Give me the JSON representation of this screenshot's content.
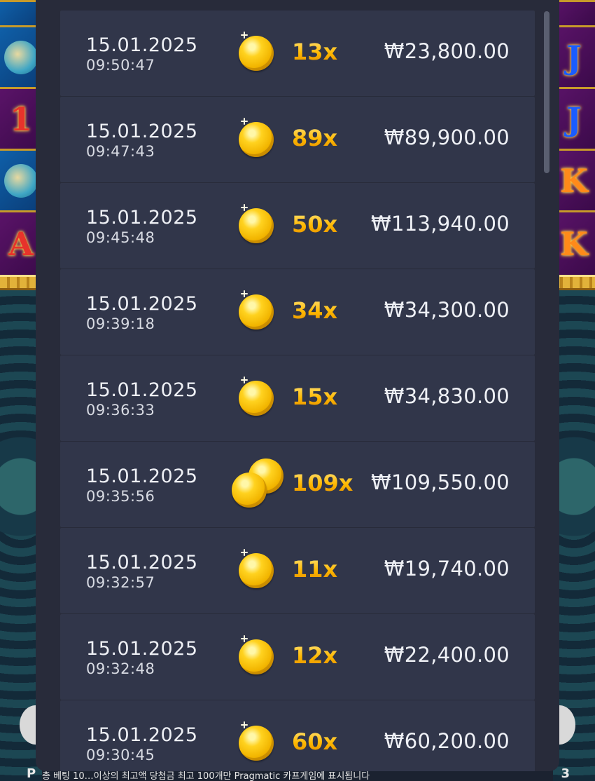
{
  "background": {
    "bottom_text": "총 베팅 10…이상의 최고액 당첨금 최고 100개만 Pragmatic 카프게임에 표시됩니다",
    "left_edge_letter": "P",
    "right_edge_letter": "3",
    "colors": {
      "reel_blue": "#0f5fa8",
      "reel_purple": "#5a1368",
      "gold": "#e2b23a",
      "pattern_teal": "#2e6a6e"
    }
  },
  "panel": {
    "colors": {
      "panel_bg": "#282b3a",
      "row_bg": "#31364a",
      "multiplier": "#ffc21a",
      "text": "#eef0f5"
    },
    "rows": [
      {
        "date": "15.01.2025",
        "time": "09:50:47",
        "multiplier": "13x",
        "amount": "₩23,800.00",
        "coin_icon": "single-coin-icon"
      },
      {
        "date": "15.01.2025",
        "time": "09:47:43",
        "multiplier": "89x",
        "amount": "₩89,900.00",
        "coin_icon": "single-coin-icon"
      },
      {
        "date": "15.01.2025",
        "time": "09:45:48",
        "multiplier": "50x",
        "amount": "₩113,940.00",
        "coin_icon": "single-coin-icon"
      },
      {
        "date": "15.01.2025",
        "time": "09:39:18",
        "multiplier": "34x",
        "amount": "₩34,300.00",
        "coin_icon": "single-coin-icon"
      },
      {
        "date": "15.01.2025",
        "time": "09:36:33",
        "multiplier": "15x",
        "amount": "₩34,830.00",
        "coin_icon": "single-coin-icon"
      },
      {
        "date": "15.01.2025",
        "time": "09:35:56",
        "multiplier": "109x",
        "amount": "₩109,550.00",
        "coin_icon": "double-coin-icon"
      },
      {
        "date": "15.01.2025",
        "time": "09:32:57",
        "multiplier": "11x",
        "amount": "₩19,740.00",
        "coin_icon": "single-coin-icon"
      },
      {
        "date": "15.01.2025",
        "time": "09:32:48",
        "multiplier": "12x",
        "amount": "₩22,400.00",
        "coin_icon": "single-coin-icon"
      },
      {
        "date": "15.01.2025",
        "time": "09:30:45",
        "multiplier": "60x",
        "amount": "₩60,200.00",
        "coin_icon": "single-coin-icon"
      }
    ]
  }
}
